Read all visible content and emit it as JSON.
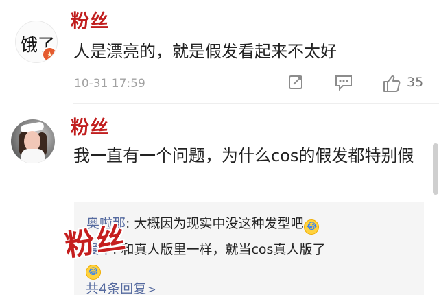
{
  "comments": [
    {
      "username": "粉丝",
      "avatar_text": "饿了",
      "avatar_badge": "★",
      "text": "人是漂亮的，就是假发看起来不太好",
      "timestamp": "10-31 17:59",
      "like_count": "35",
      "icons": [
        "share-icon",
        "comment-icon",
        "like-icon"
      ]
    },
    {
      "username": "粉丝",
      "text": "我一直有一个问题，为什么cos的假发都特别假"
    }
  ],
  "replies": [
    {
      "author": "奥啦那",
      "separator": ": ",
      "text": "大概因为现实中没这种发型吧",
      "emoji": "😂"
    },
    {
      "author": "爱平",
      "separator": ": ",
      "text": "和真人版里一样，就当cos真人版了",
      "emoji": "😂"
    }
  ],
  "reply_more": "共4条回复",
  "reply_more_arrow": ">",
  "overlay": {
    "watermark": "粉丝"
  },
  "colors": {
    "username": "#c11e1e",
    "reply_author": "#556a9f",
    "timestamp": "#a2a2a2"
  }
}
